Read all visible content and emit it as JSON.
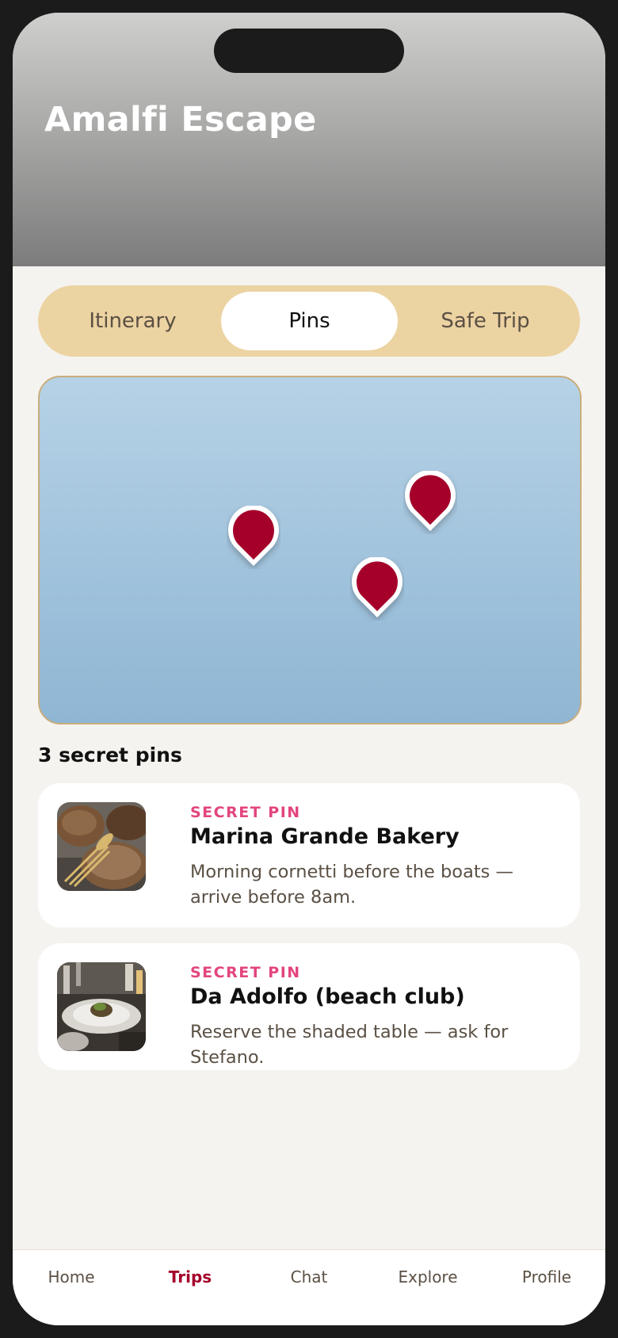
{
  "header": {
    "title": "Amalfi Escape"
  },
  "tabs": [
    {
      "label": "Itinerary",
      "active": false
    },
    {
      "label": "Pins",
      "active": true
    },
    {
      "label": "Safe Trip",
      "active": false
    }
  ],
  "map": {
    "pin_color": "#a5002a",
    "pin_count": 3
  },
  "pins_section": {
    "count_label": "3 secret pins"
  },
  "cards": [
    {
      "kicker": "SECRET PIN",
      "name": "Marina Grande Bakery",
      "description": "Morning cornetti before the boats — arrive before 8am."
    },
    {
      "kicker": "SECRET PIN",
      "name": "Da Adolfo (beach club)",
      "description": "Reserve the shaded table — ask for Stefano."
    }
  ],
  "nav": [
    {
      "label": "Home",
      "active": false
    },
    {
      "label": "Trips",
      "active": true
    },
    {
      "label": "Chat",
      "active": false
    },
    {
      "label": "Explore",
      "active": false
    },
    {
      "label": "Profile",
      "active": false
    }
  ],
  "colors": {
    "accent": "#a5002a",
    "kicker": "#e3457e",
    "tab_bar": "#ecd3a2",
    "background": "#f5f3ef"
  }
}
